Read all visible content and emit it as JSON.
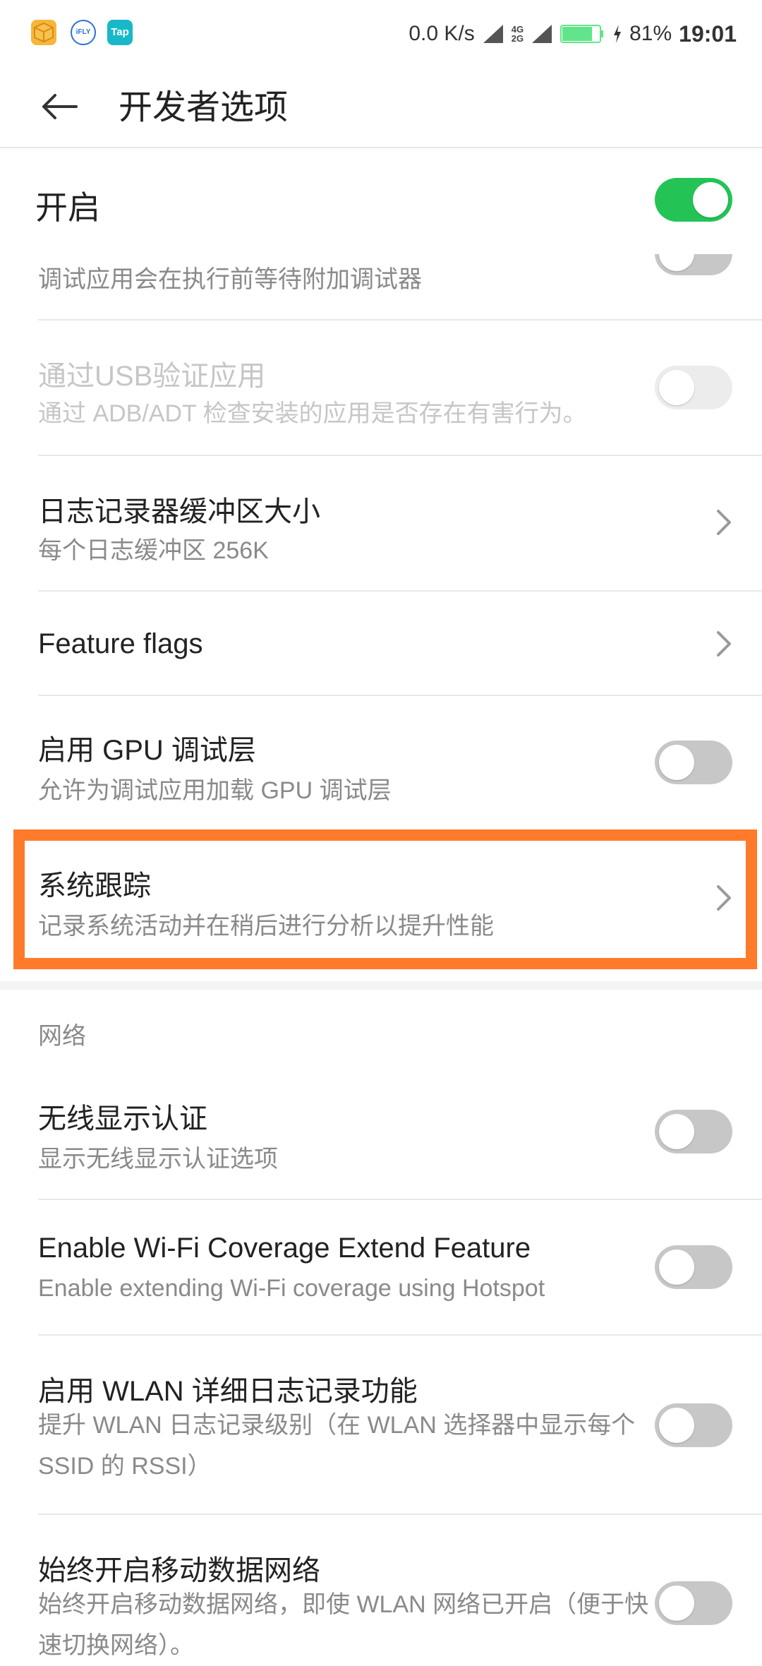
{
  "status_bar": {
    "app_icons": [
      "package-icon",
      "ifly-icon",
      "tap-icon"
    ],
    "ifly_label": "iFLY",
    "tap_label": "Tap",
    "net_speed": "0.0 K/s",
    "network_label": "4G\n2G",
    "battery_percent": "81%",
    "battery_level": 0.81,
    "time": "19:01"
  },
  "app_bar": {
    "title": "开发者选项"
  },
  "master": {
    "label": "开启",
    "on": true
  },
  "rows": [
    {
      "key": "wait_debugger",
      "subtitle": "调试应用会在执行前等待附加调试器",
      "control": "toggle",
      "on": false
    },
    {
      "key": "verify_usb",
      "title": "通过USB验证应用",
      "subtitle": "通过 ADB/ADT 检查安装的应用是否存在有害行为。",
      "control": "toggle",
      "on": false,
      "disabled": true
    },
    {
      "key": "log_buffer",
      "title": "日志记录器缓冲区大小",
      "subtitle": "每个日志缓冲区 256K",
      "control": "chevron"
    },
    {
      "key": "feature_flags",
      "title": "Feature flags",
      "control": "chevron"
    },
    {
      "key": "gpu_debug",
      "title": "启用 GPU 调试层",
      "subtitle": "允许为调试应用加载 GPU 调试层",
      "control": "toggle",
      "on": false
    },
    {
      "key": "system_trace",
      "title": "系统跟踪",
      "subtitle": "记录系统活动并在稍后进行分析以提升性能",
      "control": "chevron",
      "highlighted": true
    }
  ],
  "network_section": {
    "header": "网络",
    "rows": [
      {
        "key": "wireless_display",
        "title": "无线显示认证",
        "subtitle": "显示无线显示认证选项",
        "control": "toggle",
        "on": false
      },
      {
        "key": "wifi_coverage",
        "title": "Enable Wi-Fi Coverage Extend Feature",
        "subtitle": "Enable extending Wi-Fi coverage using Hotspot",
        "control": "toggle",
        "on": false
      },
      {
        "key": "wlan_verbose",
        "title": "启用 WLAN 详细日志记录功能",
        "subtitle": "提升 WLAN 日志记录级别（在 WLAN 选择器中显示每个 SSID 的 RSSI）",
        "control": "toggle",
        "on": false
      },
      {
        "key": "mobile_data_always",
        "title": "始终开启移动数据网络",
        "subtitle": "始终开启移动数据网络，即使 WLAN 网络已开启（便于快速切换网络）。",
        "control": "toggle",
        "on": false
      }
    ]
  },
  "colors": {
    "accent": "#23c455",
    "highlight": "#ff7a2a",
    "toggle_off": "#c7c7c7"
  }
}
